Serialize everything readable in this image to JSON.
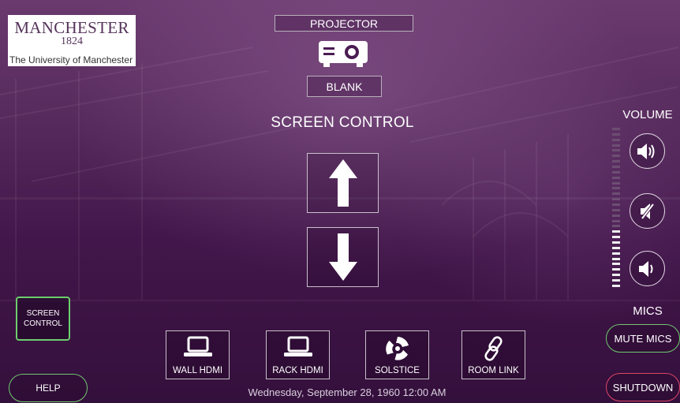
{
  "logo": {
    "name": "MANCHESTER",
    "year": "1824",
    "subtitle": "The University of Manchester"
  },
  "projector": {
    "label": "PROJECTOR",
    "icon": "projector-icon",
    "blank_label": "BLANK"
  },
  "screen": {
    "title": "SCREEN CONTROL",
    "up_icon": "arrow-up-icon",
    "down_icon": "arrow-down-icon"
  },
  "volume": {
    "label": "VOLUME",
    "level": 0.36,
    "segments": 30
  },
  "mics": {
    "label": "MICS",
    "mute_label": "MUTE MICS"
  },
  "shutdown_label": "SHUTDOWN",
  "help_label": "HELP",
  "screen_control_button": "SCREEN\nCONTROL",
  "sources": [
    {
      "label": "WALL HDMI",
      "icon": "laptop-icon"
    },
    {
      "label": "RACK HDMI",
      "icon": "laptop-icon"
    },
    {
      "label": "SOLSTICE",
      "icon": "solstice-icon"
    },
    {
      "label": "ROOM LINK",
      "icon": "link-icon"
    }
  ],
  "datetime": "Wednesday, September 28, 1960 12:00 AM",
  "colors": {
    "accent_green": "#6ec86e",
    "shutdown_red": "#e0456a",
    "background_purple": "#4a1c52"
  }
}
